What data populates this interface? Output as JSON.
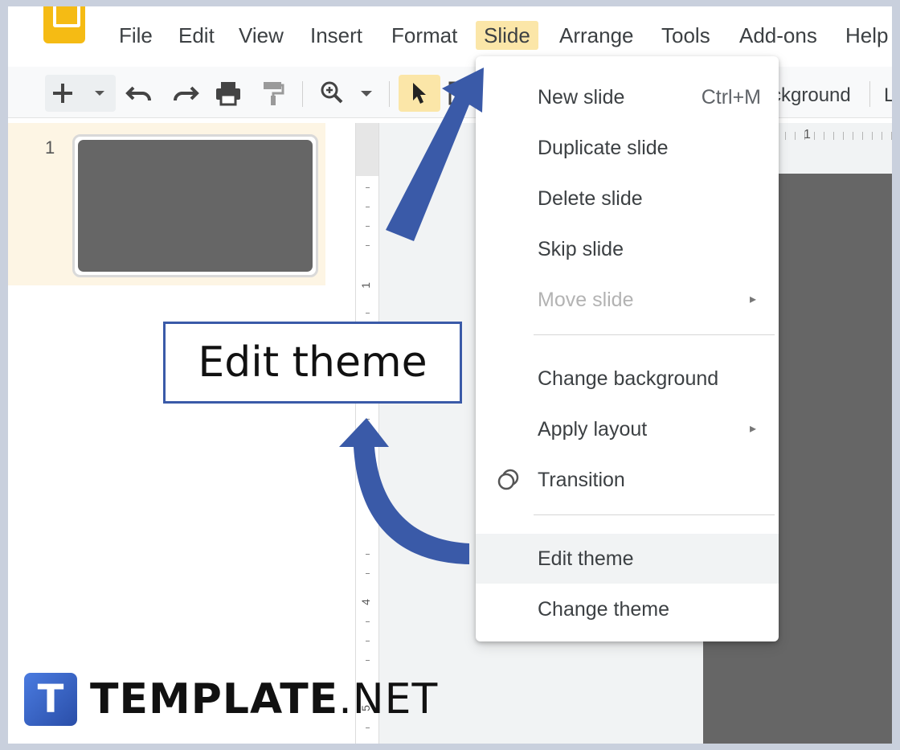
{
  "menubar": {
    "items": [
      "File",
      "Edit",
      "View",
      "Insert",
      "Format",
      "Slide",
      "Arrange",
      "Tools",
      "Add-ons",
      "Help"
    ],
    "active": "Slide"
  },
  "toolbar": {
    "icons": [
      "add-icon",
      "dropdown-caret-icon",
      "undo-icon",
      "redo-icon",
      "print-icon",
      "paint-format-icon",
      "zoom-icon",
      "select-cursor-icon",
      "select-area-icon"
    ],
    "background_label_partial": "ckground",
    "trailing_partial": "L"
  },
  "filmstrip": {
    "slide_number": "1"
  },
  "rulers": {
    "vertical_labels": [
      "1",
      "4",
      "5"
    ],
    "horizontal_label": "1"
  },
  "slide_menu": {
    "items": [
      {
        "label": "New slide",
        "shortcut": "Ctrl+M"
      },
      {
        "label": "Duplicate slide"
      },
      {
        "label": "Delete slide"
      },
      {
        "label": "Skip slide"
      },
      {
        "label": "Move slide",
        "disabled": true,
        "submenu": true
      },
      {
        "label": "Change background"
      },
      {
        "label": "Apply layout",
        "submenu": true
      },
      {
        "label": "Transition",
        "icon": "transition-icon"
      },
      {
        "label": "Edit theme",
        "highlighted": true
      },
      {
        "label": "Change theme"
      }
    ],
    "submenu_arrow": "▸"
  },
  "callout": {
    "text": "Edit theme"
  },
  "watermark": {
    "logo_letter": "T",
    "brand_bold": "TEMPLATE",
    "brand_suffix": ".NET"
  },
  "colors": {
    "accent_arrow": "#3a5aa8",
    "menu_active": "#fbe6a8",
    "app_logo": "#f5bb14",
    "slide_fill": "#666666"
  }
}
